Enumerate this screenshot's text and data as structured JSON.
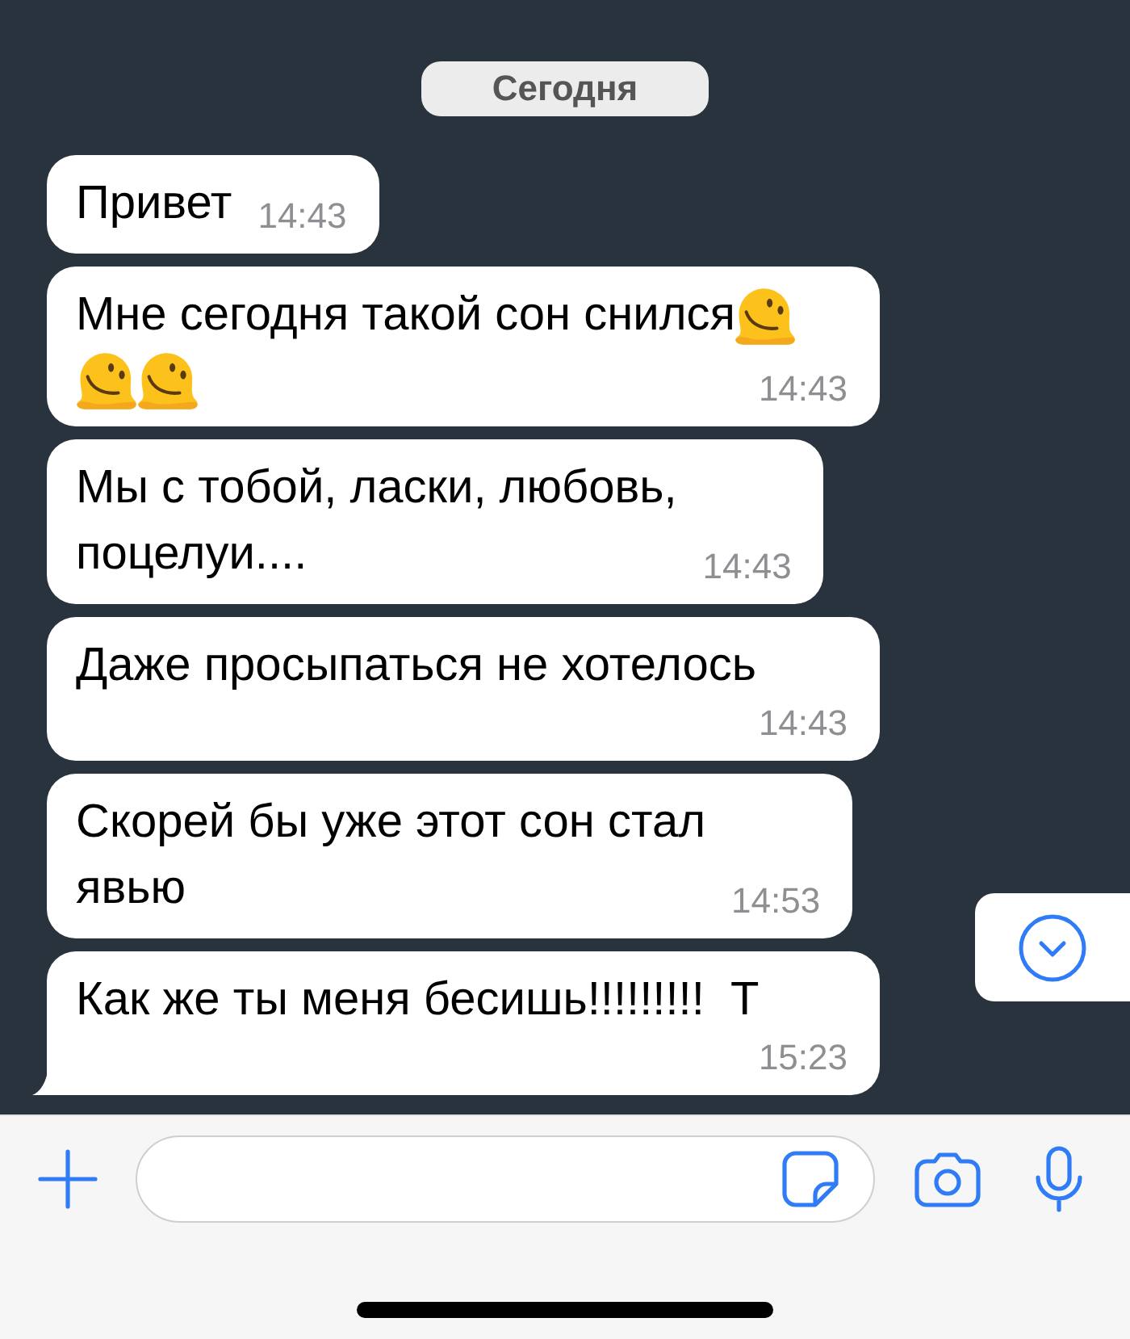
{
  "date_chip": {
    "label": "Сегодня"
  },
  "messages": [
    {
      "text": "Привет",
      "time": "14:43",
      "tail": false
    },
    {
      "text": "Мне сегодня такой сон снился",
      "emojis": [
        {
          "kind": "melting_face"
        },
        {
          "kind": "melting_face"
        },
        {
          "kind": "melting_face"
        }
      ],
      "time": "14:43",
      "tail": false
    },
    {
      "text": "Мы с тобой, ласки, любовь,\nпоцелуи....",
      "time": "14:43",
      "tail": false
    },
    {
      "text": "Даже просыпаться не хотелось",
      "time": "14:43",
      "tail": false
    },
    {
      "text": "Скорей бы уже этот сон стал\nявью",
      "time": "14:53",
      "tail": false
    },
    {
      "text": "Как же ты меня бесишь!!!!!!!!!  Т",
      "time": "15:23",
      "tail": true
    }
  ]
}
